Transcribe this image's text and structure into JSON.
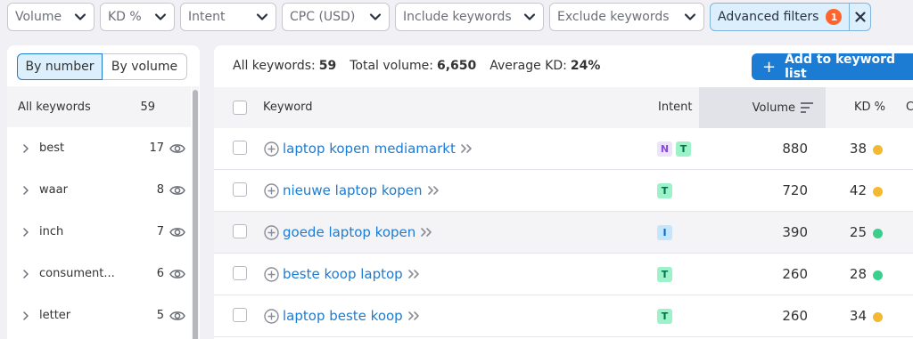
{
  "filters": [
    {
      "label": "Volume",
      "width": 98
    },
    {
      "label": "KD %",
      "width": 84
    },
    {
      "label": "Intent",
      "width": 108
    },
    {
      "label": "CPC (USD)",
      "width": 121
    },
    {
      "label": "Include keywords",
      "width": 167
    },
    {
      "label": "Exclude keywords",
      "width": 174
    }
  ],
  "advanced": {
    "label": "Advanced filters",
    "count": "1",
    "close": "×"
  },
  "groups": {
    "toggle": {
      "by_number": "By number",
      "by_volume": "By volume"
    },
    "all": {
      "label": "All keywords",
      "count": "59"
    },
    "items": [
      {
        "name": "best",
        "count": "17"
      },
      {
        "name": "waar",
        "count": "8"
      },
      {
        "name": "inch",
        "count": "7"
      },
      {
        "name": "consument...",
        "count": "6"
      },
      {
        "name": "letter",
        "count": "5"
      }
    ]
  },
  "summary": {
    "all_keywords_label": "All keywords:",
    "all_keywords_value": "59",
    "total_volume_label": "Total volume:",
    "total_volume_value": "6,650",
    "avg_kd_label": "Average KD:",
    "avg_kd_value": "24%"
  },
  "add_button": {
    "plus": "+",
    "label": "Add to keyword list"
  },
  "table": {
    "headers": {
      "keyword": "Keyword",
      "intent": "Intent",
      "volume": "Volume",
      "kd": "KD %",
      "next": "C"
    },
    "rows": [
      {
        "keyword": "laptop kopen mediamarkt",
        "intents": [
          "N",
          "T"
        ],
        "volume": "880",
        "kd": "38",
        "kd_color": "#f5b82e",
        "highlight": false
      },
      {
        "keyword": "nieuwe laptop kopen",
        "intents": [
          "T"
        ],
        "volume": "720",
        "kd": "42",
        "kd_color": "#f5b82e",
        "highlight": false
      },
      {
        "keyword": "goede laptop kopen",
        "intents": [
          "I"
        ],
        "volume": "390",
        "kd": "25",
        "kd_color": "#3bcf8e",
        "highlight": true
      },
      {
        "keyword": "beste koop laptop",
        "intents": [
          "T"
        ],
        "volume": "260",
        "kd": "28",
        "kd_color": "#3bcf8e",
        "highlight": false
      },
      {
        "keyword": "laptop beste koop",
        "intents": [
          "T"
        ],
        "volume": "260",
        "kd": "34",
        "kd_color": "#f5b82e",
        "highlight": false
      }
    ]
  },
  "intent_colors": {
    "N": {
      "bg": "#ede4fb",
      "fg": "#8a49de"
    },
    "T": {
      "bg": "#9ef2c9",
      "fg": "#00734a"
    },
    "I": {
      "bg": "#c4e5fe",
      "fg": "#006dca"
    }
  }
}
